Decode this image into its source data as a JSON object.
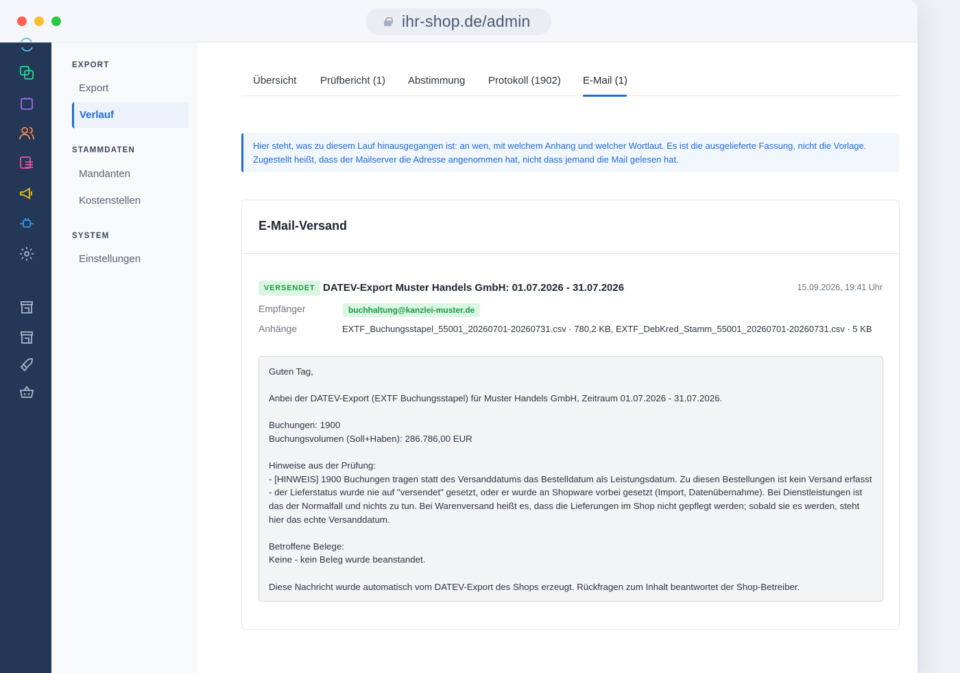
{
  "browser": {
    "url": "ihr-shop.de/admin"
  },
  "rail": {
    "icons": [
      "refresh-icon",
      "copy-icon",
      "shopping-bag-icon",
      "users-icon",
      "list-icon",
      "megaphone-icon",
      "plugin-icon",
      "gear-icon",
      "store-icon",
      "store-icon",
      "rocket-icon",
      "basket-icon"
    ],
    "colors": {
      "background": "#253757"
    }
  },
  "subnav": {
    "sections": [
      {
        "title": "EXPORT",
        "items": [
          {
            "label": "Export"
          },
          {
            "label": "Verlauf"
          }
        ]
      },
      {
        "title": "STAMMDATEN",
        "items": [
          {
            "label": "Mandanten"
          },
          {
            "label": "Kostenstellen"
          }
        ]
      },
      {
        "title": "SYSTEM",
        "items": [
          {
            "label": "Einstellungen"
          }
        ]
      }
    ],
    "active": "Verlauf"
  },
  "tabs": [
    {
      "label": "Übersicht"
    },
    {
      "label": "Prüfbericht (1)"
    },
    {
      "label": "Abstimmung"
    },
    {
      "label": "Protokoll (1902)"
    },
    {
      "label": "E-Mail (1)"
    }
  ],
  "active_tab": "E-Mail (1)",
  "info": {
    "text": "Hier steht, was zu diesem Lauf hinausgegangen ist: an wen, mit welchem Anhang und welcher Wortlaut. Es ist die ausgelieferte Fassung, nicht die Vorlage. Zugestellt heißt, dass der Mailserver die Adresse angenommen hat, nicht dass jemand die Mail gelesen hat."
  },
  "card": {
    "title": "E-Mail-Versand",
    "status": "VERSENDET",
    "subject": "DATEV-Export Muster Handels GmbH: 01.07.2026 - 31.07.2026",
    "timestamp": "15.09.2026, 19:41 Uhr",
    "recipient_label": "Empfänger",
    "recipient": "buchhaltung@kanzlei-muster.de",
    "attachments_label": "Anhänge",
    "attachments": "EXTF_Buchungsstapel_55001_20260701-20260731.csv · 780,2 KB, EXTF_DebKred_Stamm_55001_20260701-20260731.csv · 5 KB",
    "body": {
      "greeting": "Guten Tag,",
      "intro": "Anbei der DATEV-Export (EXTF Buchungsstapel) für Muster Handels GmbH, Zeitraum 01.07.2026 - 31.07.2026.",
      "bookings": "Buchungen: 1900",
      "volume": "Buchungsvolumen (Soll+Haben): 286.786,00 EUR",
      "hints_title": "Hinweise aus der Prüfung:",
      "hint": "- [HINWEIS] 1900 Buchungen tragen statt des Versanddatums das Bestelldatum als Leistungsdatum. Zu diesen Bestellungen ist kein Versand erfasst - der Lieferstatus wurde nie auf \"versendet\" gesetzt, oder er wurde an Shopware vorbei gesetzt (Import, Datenübernahme). Bei Dienstleistungen ist das der Normalfall und nichts zu tun. Bei Warenversand heißt es, dass die Lieferungen im Shop nicht gepflegt werden; sobald sie es werden, steht hier das echte Versanddatum.",
      "affected_title": "Betroffene Belege:",
      "affected": "Keine - kein Beleg wurde beanstandet.",
      "footer": "Diese Nachricht wurde automatisch vom DATEV-Export des Shops erzeugt. Rückfragen zum Inhalt beantwortet der Shop-Betreiber."
    }
  },
  "colors": {
    "accent": "#1f6ad6",
    "success": "#1a9a44",
    "success_bg": "#dcf6e4"
  }
}
